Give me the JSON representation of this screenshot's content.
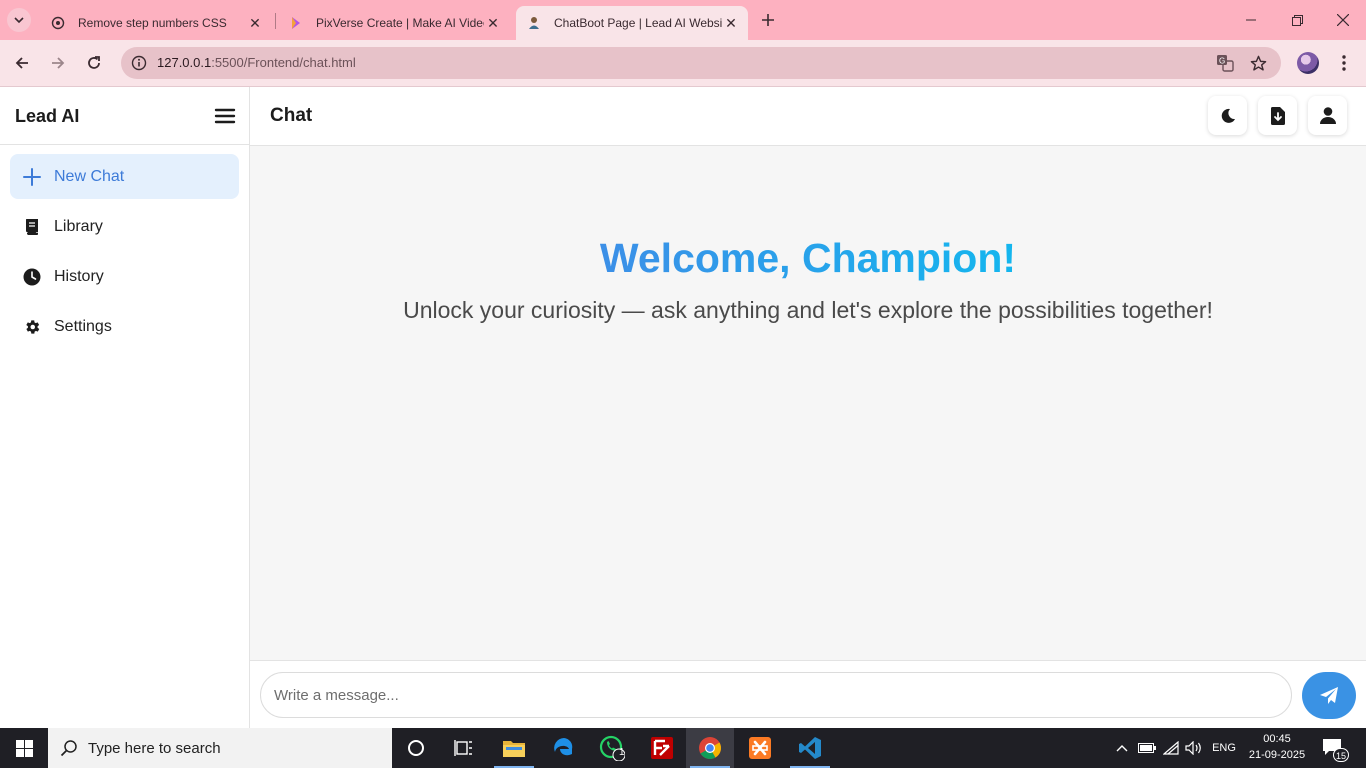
{
  "browser": {
    "tabs": [
      {
        "title": "Remove step numbers CSS",
        "favicon": "openai-icon"
      },
      {
        "title": "PixVerse Create | Make AI Video",
        "favicon": "pixverse-icon"
      },
      {
        "title": "ChatBoot Page | Lead AI Website",
        "favicon": "leadai-icon",
        "active": true
      }
    ],
    "url_host": "127.0.0.1",
    "url_rest": ":5500/Frontend/chat.html"
  },
  "sidebar": {
    "brand": "Lead AI",
    "items": [
      {
        "label": "New Chat",
        "icon": "plus-icon",
        "active": true
      },
      {
        "label": "Library",
        "icon": "book-icon"
      },
      {
        "label": "History",
        "icon": "clock-icon"
      },
      {
        "label": "Settings",
        "icon": "gear-icon"
      }
    ]
  },
  "header": {
    "title": "Chat",
    "actions": [
      "moon-icon",
      "file-download-icon",
      "user-icon"
    ]
  },
  "welcome": {
    "heading": "Welcome, Champion!",
    "subtitle": "Unlock your curiosity — ask anything and let's explore the possibilities together!"
  },
  "composer": {
    "placeholder": "Write a message...",
    "send_icon": "paper-plane-icon"
  },
  "taskbar": {
    "search_placeholder": "Type here to search",
    "whatsapp_badge": "1",
    "language": "ENG",
    "time": "00:45",
    "date": "21-09-2025",
    "notification_count": "15"
  },
  "colors": {
    "accent": "#3a92e4",
    "heading_gradient_start": "#3c8fe7",
    "heading_gradient_end": "#14b6ee",
    "active_nav_bg": "#e4f0fd",
    "browser_chrome": "#fdb1c0"
  }
}
